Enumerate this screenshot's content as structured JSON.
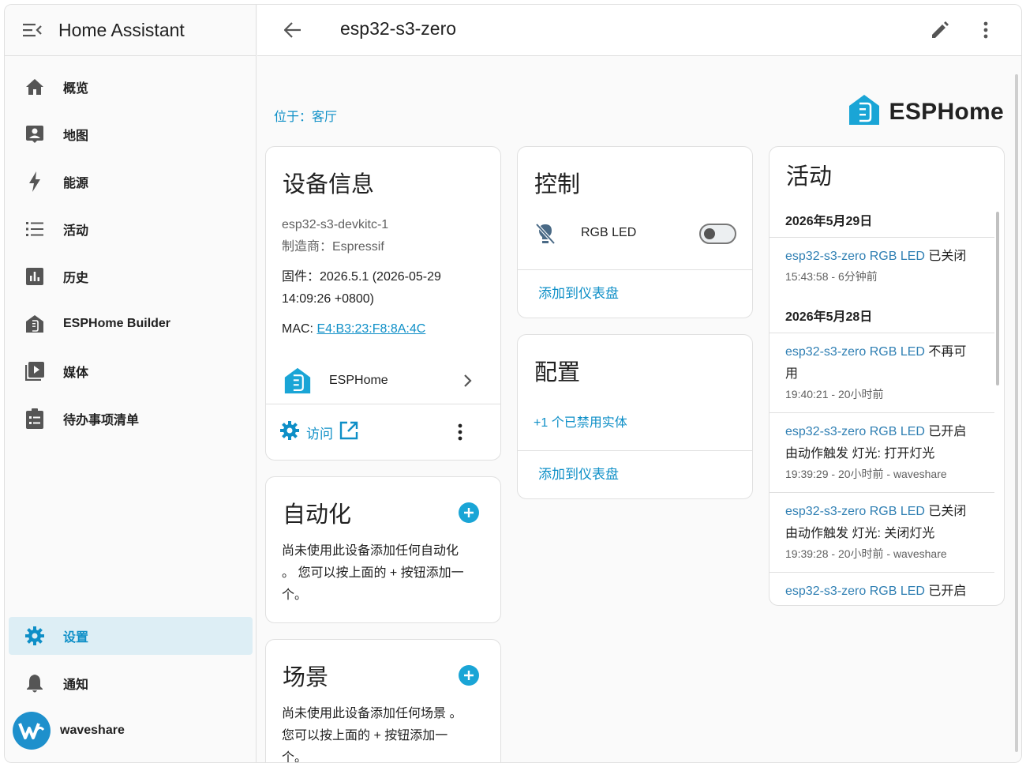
{
  "app": {
    "title": "Home Assistant"
  },
  "sidebar": {
    "items": [
      {
        "label": "概览",
        "icon": "home-icon"
      },
      {
        "label": "地图",
        "icon": "map-icon"
      },
      {
        "label": "能源",
        "icon": "lightning-icon"
      },
      {
        "label": "活动",
        "icon": "list-icon"
      },
      {
        "label": "历史",
        "icon": "chart-box-icon"
      },
      {
        "label": "ESPHome Builder",
        "icon": "esphome-icon"
      },
      {
        "label": "媒体",
        "icon": "media-icon"
      },
      {
        "label": "待办事项清单",
        "icon": "clipboard-list-icon"
      }
    ],
    "settings": "设置",
    "notifications": "通知",
    "user": "waveshare",
    "active_color": "#0e8fc7"
  },
  "topbar": {
    "title": "esp32-s3-zero"
  },
  "area_link": "位于：客厅",
  "brand": {
    "name": "ESPHome"
  },
  "device_info": {
    "title": "设备信息",
    "model": "esp32-s3-devkitc-1",
    "manufacturer": "制造商：Espressif",
    "firmware_line1": "固件：2026.5.1 (2026-05-29",
    "firmware_line2": "14:09:26 +0800)",
    "mac_label": "MAC: ",
    "mac_value": "E4:B3:23:F8:8A:4C",
    "integration": "ESPHome",
    "visit": "访问"
  },
  "control": {
    "title": "控制",
    "entity": "RGB LED",
    "toggle_state": "off",
    "add_dashboard": "添加到仪表盘"
  },
  "config": {
    "title": "配置",
    "disabled_entities": "+1 个已禁用实体",
    "add_dashboard": "添加到仪表盘"
  },
  "automation": {
    "title": "自动化",
    "desc_line1": "尚未使用此设备添加任何自动化",
    "desc_line2": "。 您可以按上面的 + 按钮添加一",
    "desc_line3": "个。"
  },
  "scene": {
    "title": "场景",
    "desc_line1": "尚未使用此设备添加任何场景 。",
    "desc_line2": "您可以按上面的 + 按钮添加一",
    "desc_line3": "个。"
  },
  "activity": {
    "title": "活动",
    "date1": "2026年5月29日",
    "date2": "2026年5月28日",
    "entries": [
      {
        "who": "esp32-s3-zero RGB LED",
        "what": " 已关闭",
        "line2": "",
        "meta": "15:43:58 - 6分钟前"
      },
      {
        "who": "esp32-s3-zero RGB LED",
        "what": " 不再可",
        "line2": "用",
        "meta": "19:40:21 - 20小时前"
      },
      {
        "who": "esp32-s3-zero RGB LED",
        "what": " 已开启",
        "line2": "由动作触发 灯光: 打开灯光",
        "meta": "19:39:29 - 20小时前 - waveshare"
      },
      {
        "who": "esp32-s3-zero RGB LED",
        "what": " 已关闭",
        "line2": "由动作触发 灯光: 关闭灯光",
        "meta": "19:39:28 - 20小时前 - waveshare"
      },
      {
        "who": "esp32-s3-zero RGB LED",
        "what": " 已开启",
        "line2": "",
        "meta": ""
      }
    ]
  }
}
